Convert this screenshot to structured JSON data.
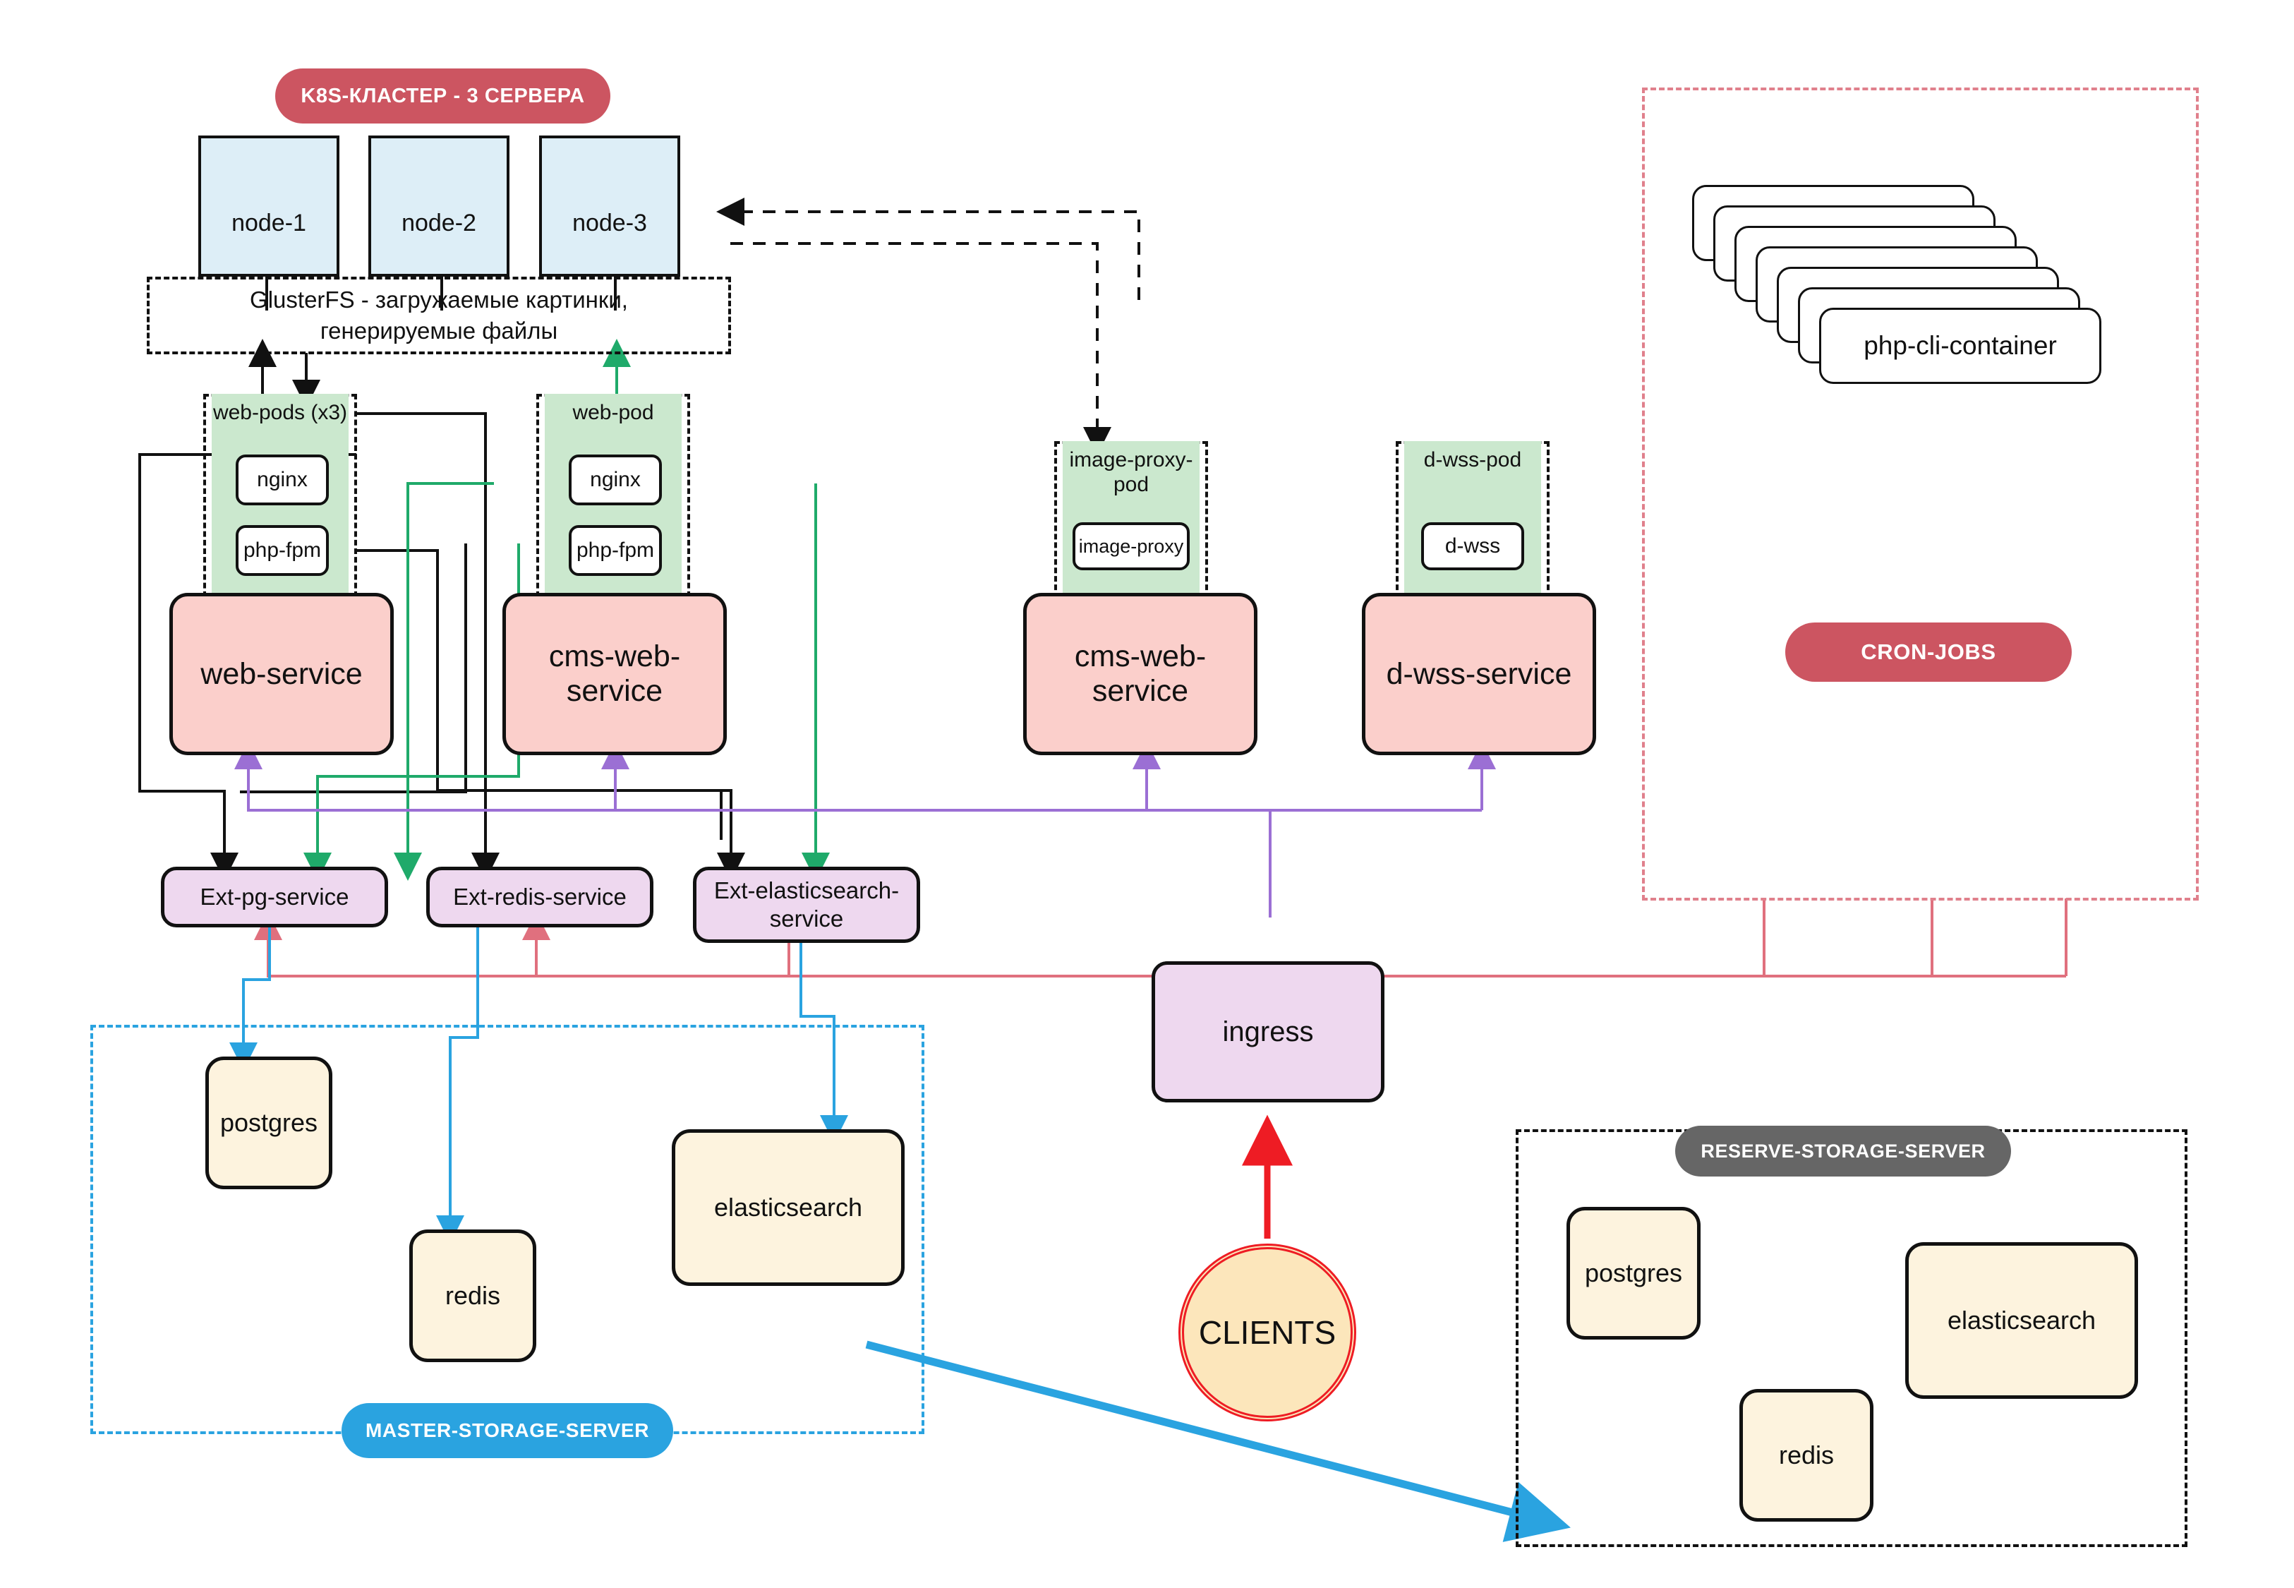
{
  "diagram": {
    "title_badges": {
      "k8s_cluster": "K8S-КЛАСТЕР - 3 СЕРВЕРА",
      "cron_jobs": "CRON-JOBS",
      "master_storage": "MASTER-STORAGE-SERVER",
      "reserve_storage": "RESERVE-STORAGE-SERVER"
    },
    "k8s_nodes": [
      {
        "label": "node-1"
      },
      {
        "label": "node-2"
      },
      {
        "label": "node-3"
      }
    ],
    "glusterfs": {
      "line1": "GlusterFS - загружаемые картинки,",
      "line2": "генерируемые файлы"
    },
    "pods": [
      {
        "label": "web-pods (x3)",
        "containers": [
          "nginx",
          "php-fpm"
        ]
      },
      {
        "label": "web-pod",
        "containers": [
          "nginx",
          "php-fpm"
        ]
      },
      {
        "label": "image-proxy-pod",
        "containers": [
          "image-proxy"
        ]
      },
      {
        "label": "d-wss-pod",
        "containers": [
          "d-wss"
        ]
      }
    ],
    "services": [
      {
        "label": "web-service"
      },
      {
        "label": "cms-web-service"
      },
      {
        "label": "cms-web-service"
      },
      {
        "label": "d-wss-service"
      }
    ],
    "ext_services": [
      {
        "label": "Ext-pg-service"
      },
      {
        "label": "Ext-redis-service"
      },
      {
        "label": "Ext-elasticsearch-service"
      }
    ],
    "ingress": {
      "label": "ingress"
    },
    "clients": {
      "label": "CLIENTS"
    },
    "cron": {
      "container_label": "php-cli-container",
      "stack_count": 7
    },
    "master_storage_items": [
      {
        "label": "postgres"
      },
      {
        "label": "redis"
      },
      {
        "label": "elasticsearch"
      }
    ],
    "reserve_storage_items": [
      {
        "label": "postgres"
      },
      {
        "label": "redis"
      },
      {
        "label": "elasticsearch"
      }
    ],
    "colors": {
      "accent_red": "#cc5561",
      "accent_blue": "#2aa3e0",
      "accent_gray": "#666666",
      "service_fill": "#fbcfcb",
      "ext_service_fill": "#eed8ef",
      "pod_fill": "#cbe8ce",
      "node_fill": "#ddeef7",
      "storage_fill": "#fdf3de",
      "wire_green": "#1faa6a",
      "wire_purple": "#9b6fd4",
      "wire_blue": "#2aa3e0",
      "wire_pink": "#e0707e",
      "wire_red": "#ee1c24",
      "wire_black": "#111111"
    }
  }
}
